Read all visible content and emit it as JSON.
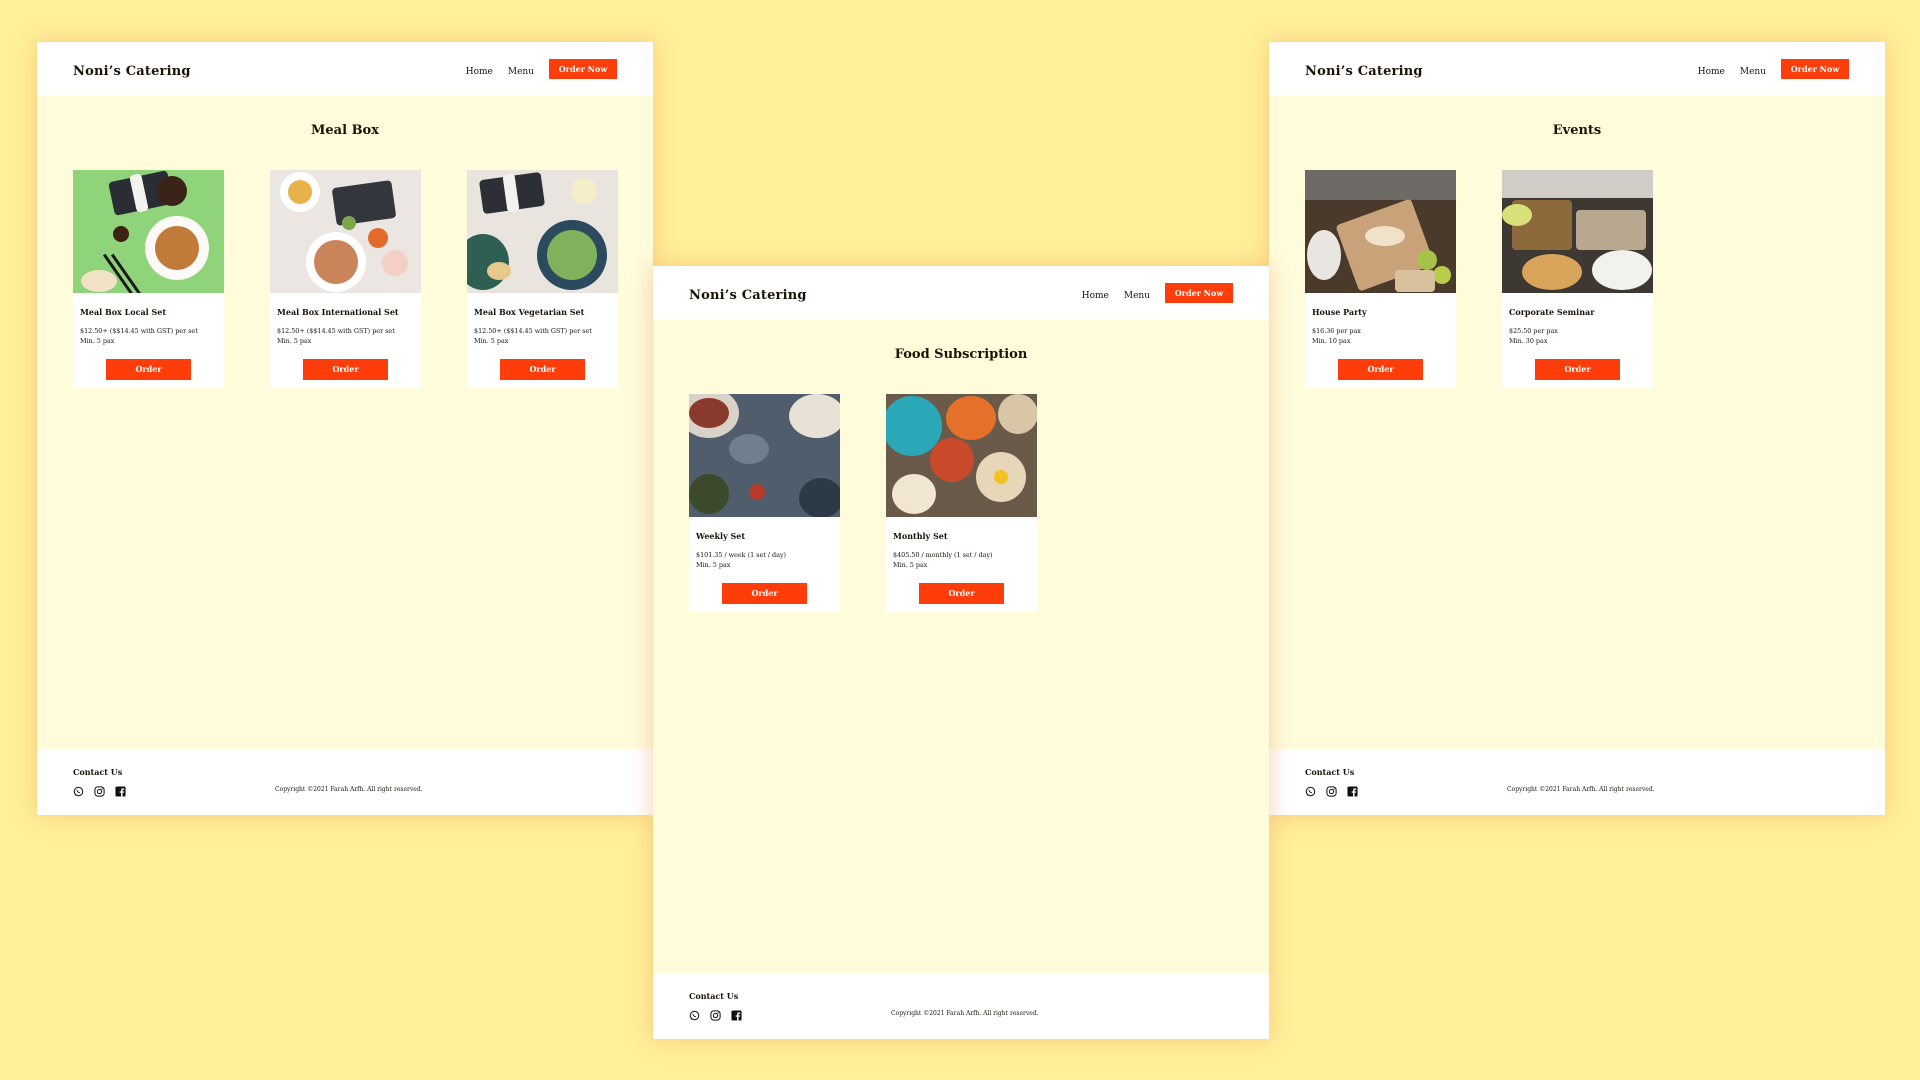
{
  "brand": "Noni’s Catering",
  "nav": {
    "home": "Home",
    "menu": "Menu",
    "order_now": "Order Now"
  },
  "card_button": "Order",
  "footer": {
    "contact": "Contact Us",
    "copyright": "Copyright ©2021 Farah Arfh. All right reserved."
  },
  "icons": [
    "whatsapp-icon",
    "instagram-icon",
    "facebook-icon"
  ],
  "colors": {
    "background": "#FFF099",
    "page": "#FFFCDC",
    "accent": "#FF3D0A"
  },
  "pages": [
    {
      "title": "Meal Box",
      "cards": [
        {
          "name": "Meal Box Local Set",
          "price": "$12.50+ ($$14.45 with GST) per set",
          "min": "Min. 5 pax"
        },
        {
          "name": "Meal Box International Set",
          "price": "$12.50+ ($$14.45 with GST) per set",
          "min": "Min. 5 pax"
        },
        {
          "name": "Meal Box Vegetarian Set",
          "price": "$12.50+ ($$14.45 with GST) per set",
          "min": "Min. 5 pax"
        }
      ]
    },
    {
      "title": "Events",
      "cards": [
        {
          "name": "House Party",
          "price": "$16.36 per pax",
          "min": "Min. 10 pax"
        },
        {
          "name": "Corporate Seminar",
          "price": "$25.50 per pax",
          "min": "Min. 30 pax"
        }
      ]
    },
    {
      "title": "Food Subscription",
      "cards": [
        {
          "name": "Weekly Set",
          "price": "$101.35 / week (1 set / day)",
          "min": "Min. 5 pax"
        },
        {
          "name": "Monthly Set",
          "price": "$405.50 / monthly (1 set / day)",
          "min": "Min. 5 pax"
        }
      ]
    }
  ]
}
